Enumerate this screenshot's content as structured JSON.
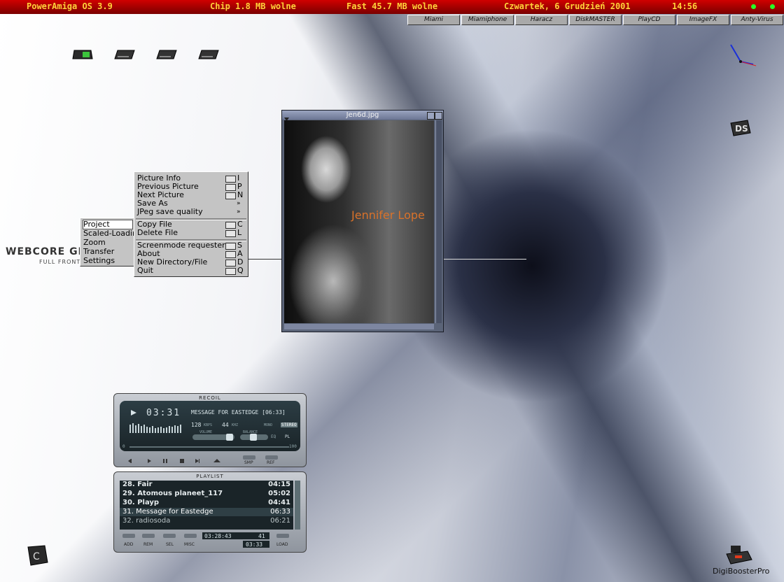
{
  "topbar": {
    "os": "PowerAmiga OS 3.9",
    "chip": "Chip 1.8 MB wolne",
    "fast": "Fast 45.7 MB wolne",
    "date": "Czwartek, 6 Grudzień 2001",
    "time": "14:56",
    "colors": {
      "bar": "#b00000",
      "text": "#ffd23a",
      "led": "#27ff27"
    }
  },
  "apps": [
    "Miami",
    "Miamiphone",
    "Haracz",
    "DiskMASTER",
    "PlayCD",
    "ImageFX",
    "Anty-Virus"
  ],
  "image_window": {
    "title": "Jen6d.jpg",
    "caption": "Jennifer Lope"
  },
  "project_menu": {
    "items": [
      {
        "label": "Project",
        "selected": true
      },
      {
        "label": "Scaled-Loadin"
      },
      {
        "label": "Zoom"
      },
      {
        "label": "Transfer"
      },
      {
        "label": "Settings"
      }
    ]
  },
  "sub_menu": {
    "items": [
      {
        "label": "Picture Info",
        "key": "I"
      },
      {
        "label": "Previous Picture",
        "key": "P"
      },
      {
        "label": "Next Picture",
        "key": "N"
      },
      {
        "label": "Save As",
        "key": "»"
      },
      {
        "label": "JPeg save quality",
        "key": "»"
      },
      {
        "label": "Copy File",
        "key": "C"
      },
      {
        "label": "Delete File",
        "key": "L"
      },
      {
        "label": "Screenmode requester",
        "key": "S"
      },
      {
        "label": "About",
        "key": "A"
      },
      {
        "label": "New Directory/File",
        "key": "D"
      },
      {
        "label": "Quit",
        "key": "Q"
      }
    ]
  },
  "logo": {
    "main": "WEBCORE GFX",
    "sub": "FULL FRONT"
  },
  "player": {
    "title": "RECOIL",
    "time": "03:31",
    "track": "MESSAGE FOR EASTEDGE [06:33]",
    "kbps": "128",
    "kbps_label": "KBPS",
    "khz": "44",
    "khz_label": "KHZ",
    "mono": "MONO",
    "stereo": "STEREO",
    "volume": "VOLUME",
    "balance": "BALANCE",
    "eq": "EQ",
    "pl": "PL",
    "range_min": "0",
    "range_max": "100",
    "smp": "SMP",
    "ref": "REF"
  },
  "playlist": {
    "title": "PLAYLIST",
    "rows": [
      {
        "name": "28. Fair",
        "time": "04:15",
        "style": "bold"
      },
      {
        "name": "29. Atomous planeet_117",
        "time": "05:02",
        "style": "bold"
      },
      {
        "name": "30. Playp",
        "time": "04:41",
        "style": "bold"
      },
      {
        "name": "31. Message for Eastedge",
        "time": "06:33",
        "style": "current"
      },
      {
        "name": "32. radiosoda",
        "time": "06:21",
        "style": "dim"
      }
    ],
    "total": "03:28:43",
    "count": "41",
    "elapsed": "03:33",
    "buttons": [
      "ADD",
      "REM",
      "SEL",
      "MISC",
      "LOAD"
    ]
  },
  "desktop": {
    "digibooster_label": "DigiBoosterPro"
  }
}
